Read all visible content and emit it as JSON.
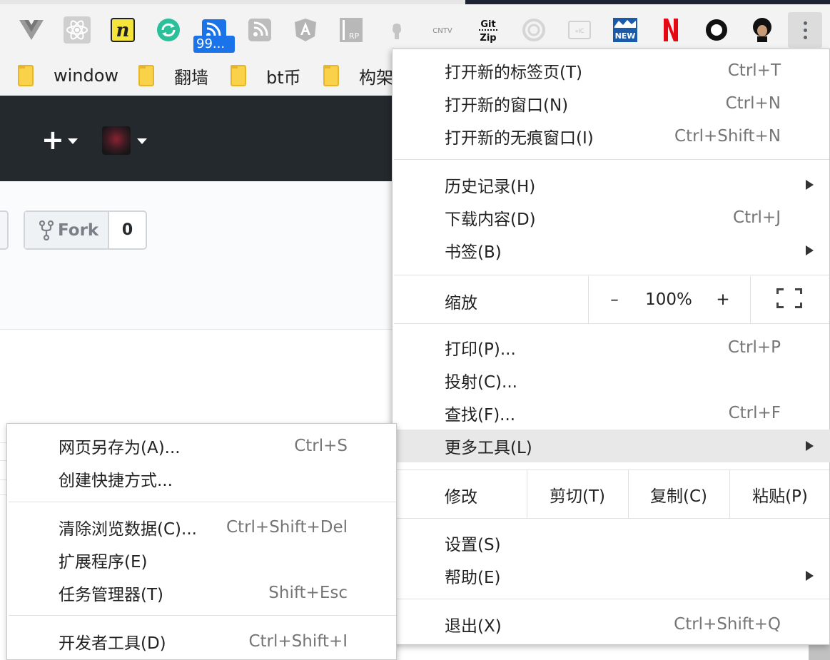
{
  "extension_badge": "99...",
  "extensions": [
    "vue-devtools-icon",
    "react-devtools-icon",
    "notion-n-icon",
    "sync-icon",
    "rss-feed-icon",
    "feed-reader-icon",
    "angular-icon",
    "axure-rp-icon",
    "github-octocat-icon",
    "cntv-icon",
    "gitzip-icon",
    "spinner-icon",
    "picture-in-picture-icon",
    "new-badge-icon",
    "netflix-icon",
    "circle-icon",
    "avatar-ext-icon"
  ],
  "bookmarks": [
    {
      "label": "window"
    },
    {
      "label": "翻墙"
    },
    {
      "label": "bt币"
    },
    {
      "label": "构架"
    }
  ],
  "page": {
    "plus": "+",
    "fork_label": "Fork",
    "fork_count": "0"
  },
  "main_menu": {
    "new_tab": {
      "label": "打开新的标签页(T)",
      "shortcut": "Ctrl+T"
    },
    "new_window": {
      "label": "打开新的窗口(N)",
      "shortcut": "Ctrl+N"
    },
    "new_incognito": {
      "label": "打开新的无痕窗口(I)",
      "shortcut": "Ctrl+Shift+N"
    },
    "history": {
      "label": "历史记录(H)"
    },
    "downloads": {
      "label": "下载内容(D)",
      "shortcut": "Ctrl+J"
    },
    "bookmarks": {
      "label": "书签(B)"
    },
    "zoom": {
      "label": "缩放",
      "minus": "–",
      "value": "100%",
      "plus": "+"
    },
    "print": {
      "label": "打印(P)...",
      "shortcut": "Ctrl+P"
    },
    "cast": {
      "label": "投射(C)..."
    },
    "find": {
      "label": "查找(F)...",
      "shortcut": "Ctrl+F"
    },
    "more_tools": {
      "label": "更多工具(L)"
    },
    "edit": {
      "label": "修改",
      "cut": "剪切(T)",
      "copy": "复制(C)",
      "paste": "粘贴(P)"
    },
    "settings": {
      "label": "设置(S)"
    },
    "help": {
      "label": "帮助(E)"
    },
    "exit": {
      "label": "退出(X)",
      "shortcut": "Ctrl+Shift+Q"
    }
  },
  "more_tools_menu": {
    "save_page": {
      "label": "网页另存为(A)...",
      "shortcut": "Ctrl+S"
    },
    "create_shortcut": {
      "label": "创建快捷方式..."
    },
    "clear_data": {
      "label": "清除浏览数据(C)...",
      "shortcut": "Ctrl+Shift+Del"
    },
    "extensions": {
      "label": "扩展程序(E)"
    },
    "task_manager": {
      "label": "任务管理器(T)",
      "shortcut": "Shift+Esc"
    },
    "dev_tools": {
      "label": "开发者工具(D)",
      "shortcut": "Ctrl+Shift+I"
    }
  }
}
